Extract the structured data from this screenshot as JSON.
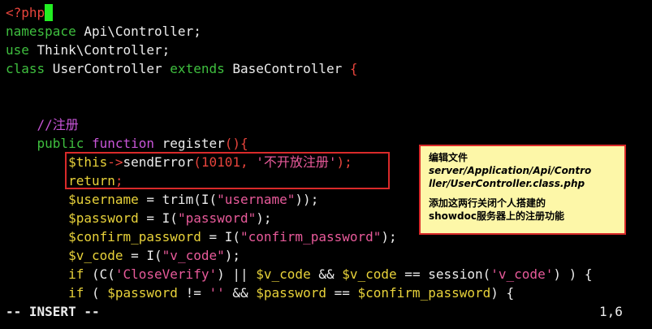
{
  "editor": {
    "lines": [
      {
        "tokens": [
          {
            "t": "<?php",
            "c": "red"
          }
        ],
        "cursor": true
      },
      {
        "tokens": [
          {
            "t": "namespace",
            "c": "green"
          },
          {
            "t": " Api\\Controller;",
            "c": "white"
          }
        ]
      },
      {
        "tokens": [
          {
            "t": "use",
            "c": "green"
          },
          {
            "t": " Think\\Controller;",
            "c": "white"
          }
        ]
      },
      {
        "tokens": [
          {
            "t": "class",
            "c": "green"
          },
          {
            "t": " UserController ",
            "c": "white"
          },
          {
            "t": "extends",
            "c": "green"
          },
          {
            "t": " BaseController ",
            "c": "white"
          },
          {
            "t": "{",
            "c": "red"
          }
        ]
      },
      {
        "tokens": []
      },
      {
        "tokens": []
      },
      {
        "tokens": [
          {
            "t": "    //注册",
            "c": "purple"
          }
        ]
      },
      {
        "tokens": [
          {
            "t": "    public ",
            "c": "green"
          },
          {
            "t": "function",
            "c": "purple"
          },
          {
            "t": " register",
            "c": "white"
          },
          {
            "t": "(){",
            "c": "red"
          }
        ]
      },
      {
        "tokens": [
          {
            "t": "        ",
            "c": "white"
          },
          {
            "t": "$this",
            "c": "yellow"
          },
          {
            "t": "->",
            "c": "red"
          },
          {
            "t": "sendError",
            "c": "white"
          },
          {
            "t": "(10101, ",
            "c": "red"
          },
          {
            "t": "'不开放注册'",
            "c": "pink"
          },
          {
            "t": ");",
            "c": "red"
          }
        ]
      },
      {
        "tokens": [
          {
            "t": "        return",
            "c": "yellow"
          },
          {
            "t": ";",
            "c": "red"
          }
        ]
      },
      {
        "tokens": [
          {
            "t": "        ",
            "c": "white"
          },
          {
            "t": "$username",
            "c": "yellow"
          },
          {
            "t": " = trim(I(",
            "c": "white"
          },
          {
            "t": "\"username\"",
            "c": "pink"
          },
          {
            "t": "));",
            "c": "white"
          }
        ]
      },
      {
        "tokens": [
          {
            "t": "        ",
            "c": "white"
          },
          {
            "t": "$password",
            "c": "yellow"
          },
          {
            "t": " = I(",
            "c": "white"
          },
          {
            "t": "\"password\"",
            "c": "pink"
          },
          {
            "t": ");",
            "c": "white"
          }
        ]
      },
      {
        "tokens": [
          {
            "t": "        ",
            "c": "white"
          },
          {
            "t": "$confirm_password",
            "c": "yellow"
          },
          {
            "t": " = I(",
            "c": "white"
          },
          {
            "t": "\"confirm_password\"",
            "c": "pink"
          },
          {
            "t": ");",
            "c": "white"
          }
        ]
      },
      {
        "tokens": [
          {
            "t": "        ",
            "c": "white"
          },
          {
            "t": "$v_code",
            "c": "yellow"
          },
          {
            "t": " = I(",
            "c": "white"
          },
          {
            "t": "\"v_code\"",
            "c": "pink"
          },
          {
            "t": ");",
            "c": "white"
          }
        ]
      },
      {
        "tokens": [
          {
            "t": "        if",
            "c": "yellow"
          },
          {
            "t": " (C(",
            "c": "white"
          },
          {
            "t": "'CloseVerify'",
            "c": "pink"
          },
          {
            "t": ") || ",
            "c": "white"
          },
          {
            "t": "$v_code",
            "c": "yellow"
          },
          {
            "t": " && ",
            "c": "white"
          },
          {
            "t": "$v_code",
            "c": "yellow"
          },
          {
            "t": " == session(",
            "c": "white"
          },
          {
            "t": "'v_code'",
            "c": "pink"
          },
          {
            "t": ") ) {",
            "c": "white"
          }
        ]
      },
      {
        "tokens": [
          {
            "t": "        if",
            "c": "yellow"
          },
          {
            "t": " ( ",
            "c": "white"
          },
          {
            "t": "$password",
            "c": "yellow"
          },
          {
            "t": " != ",
            "c": "white"
          },
          {
            "t": "''",
            "c": "pink"
          },
          {
            "t": " && ",
            "c": "white"
          },
          {
            "t": "$password",
            "c": "yellow"
          },
          {
            "t": " == ",
            "c": "white"
          },
          {
            "t": "$confirm_password",
            "c": "yellow"
          },
          {
            "t": ") {",
            "c": "white"
          }
        ]
      }
    ]
  },
  "status": {
    "mode": "-- INSERT --",
    "position": "1,6"
  },
  "note": {
    "line1": "编辑文件",
    "line2": "server/Application/Api/Contro",
    "line3": "ller/UserController.class.php",
    "line4": "添加这两行关闭个人搭建的",
    "line5": "showdoc服务器上的注册功能"
  },
  "colors": {
    "red": "#e8443c",
    "green": "#3fbf3f",
    "purple": "#c855d8",
    "white": "#ececec",
    "yellow": "#e8d23a",
    "pink": "#e85a9a",
    "cursor": "#22ee22",
    "annotation_border": "#d92a2a",
    "annotation_bg": "#fdf7a8"
  }
}
